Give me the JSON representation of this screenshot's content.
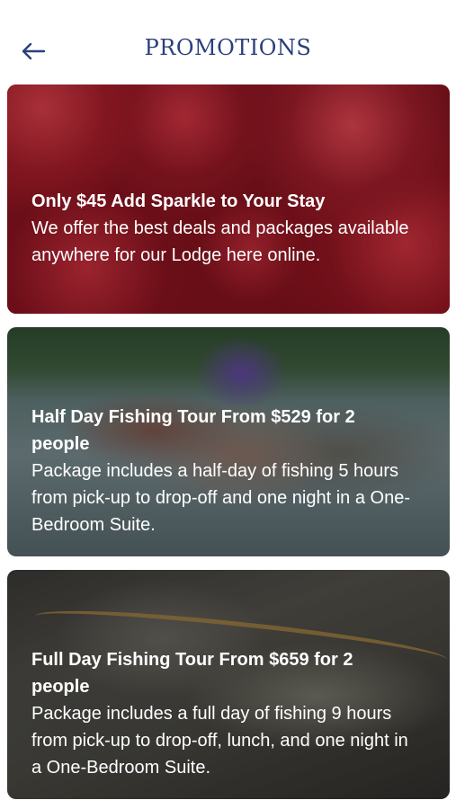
{
  "header": {
    "title": "PROMOTIONS"
  },
  "promotions": [
    {
      "title": "Only $45 Add Sparkle to Your Stay",
      "description": "We offer the best deals and packages available anywhere for our Lodge here online."
    },
    {
      "title": "Half Day Fishing Tour From $529 for 2 people",
      "description": "Package includes a half-day of fishing 5 hours from pick-up to drop-off and one night in a One-Bedroom Suite."
    },
    {
      "title": "Full Day Fishing Tour From $659 for 2 people",
      "description": "Package includes a full day of fishing 9 hours from pick-up to drop-off, lunch, and one night in a One-Bedroom Suite."
    }
  ],
  "colors": {
    "title": "#2b3f7b",
    "card_text": "#ffffff"
  }
}
